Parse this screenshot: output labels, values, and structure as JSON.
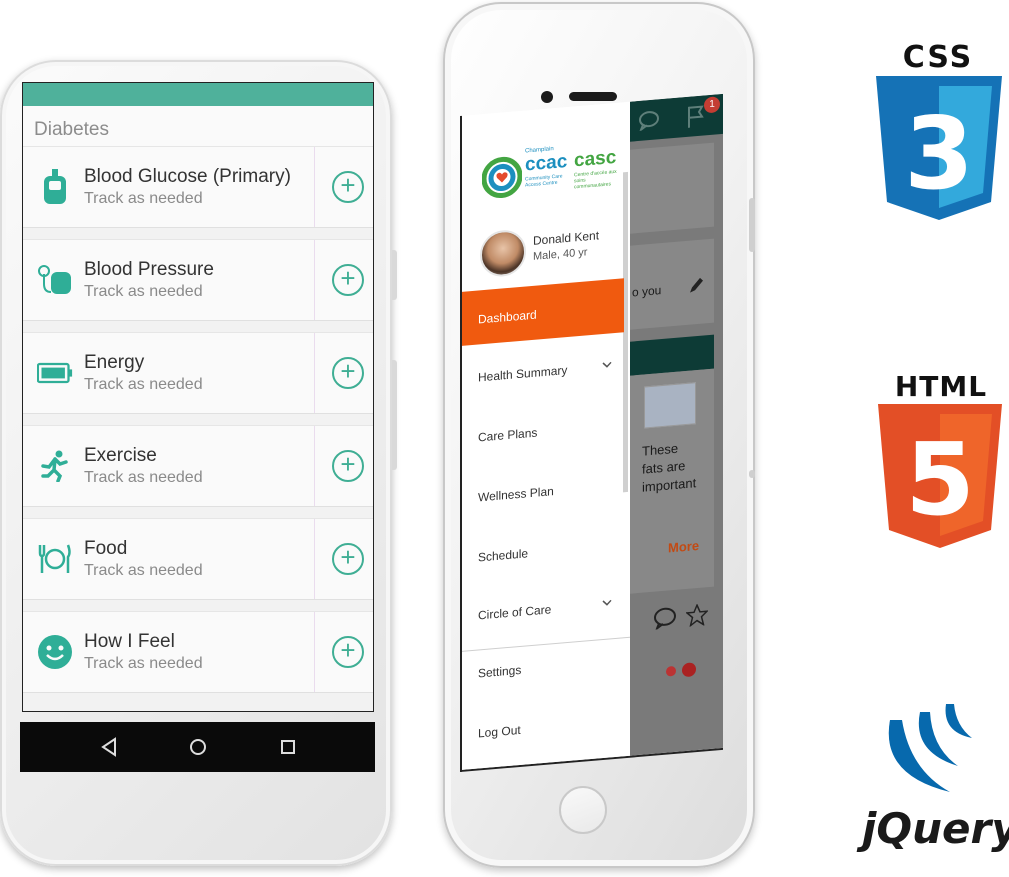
{
  "android": {
    "section_title": "Diabetes",
    "items": [
      {
        "title": "Blood Glucose (Primary)",
        "sub": "Track as needed",
        "icon": "glucose-meter-icon"
      },
      {
        "title": "Blood Pressure",
        "sub": "Track as needed",
        "icon": "blood-pressure-cuff-icon"
      },
      {
        "title": "Energy",
        "sub": "Track as needed",
        "icon": "battery-icon"
      },
      {
        "title": "Exercise",
        "sub": "Track as needed",
        "icon": "running-person-icon"
      },
      {
        "title": "Food",
        "sub": "Track as needed",
        "icon": "fork-plate-knife-icon"
      },
      {
        "title": "How I Feel",
        "sub": "Track as needed",
        "icon": "smiley-face-icon"
      }
    ],
    "add_symbol": "+",
    "accent_color": "#4fb19b"
  },
  "iphone": {
    "logo_small": "Champlain",
    "logo_text_en": "ccac",
    "logo_text_fr": "casc",
    "logo_tagline_en": "Community Care Access Centre",
    "logo_tagline_fr": "Centre d'accès aux soins communautaires",
    "user_name": "Donald Kent",
    "user_meta": "Male, 40 yr",
    "menu": {
      "active": "Dashboard",
      "items": [
        "Health Summary",
        "Care Plans",
        "Wellness Plan",
        "Schedule",
        "Circle of Care"
      ],
      "footer": [
        "Settings",
        "Log Out"
      ]
    },
    "content": {
      "badge_count": "1",
      "snippet": "o you",
      "article_lines": [
        "These",
        "fats are",
        "important"
      ],
      "more_label": "More"
    },
    "accent_color": "#f05a0f"
  },
  "logos": {
    "css_label": "CSS",
    "css_number": "3",
    "html_label": "HTML",
    "html_number": "5",
    "jquery_label": "jQuery"
  }
}
